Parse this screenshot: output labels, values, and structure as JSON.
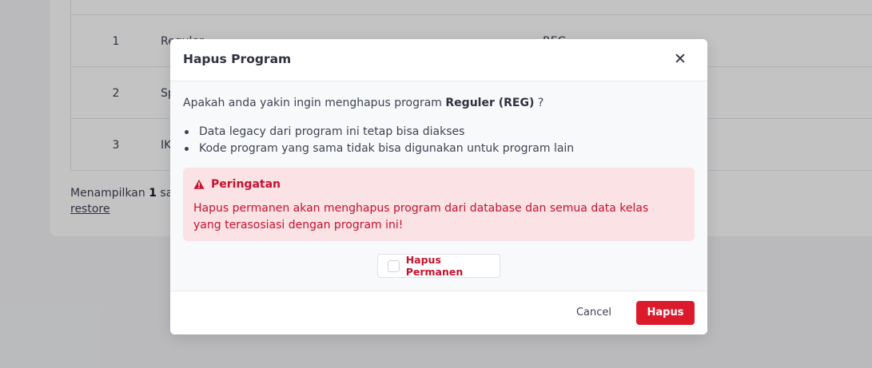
{
  "background": {
    "table": {
      "rows": [
        {
          "no": "1",
          "name": "Reguler",
          "code": "REG"
        },
        {
          "no": "2",
          "name": "Sp"
        },
        {
          "no": "3",
          "name": "IK"
        }
      ]
    },
    "footer": {
      "prefix": "Menampilkan ",
      "count": "1",
      "suffix": " sa",
      "restore_link": "restore"
    }
  },
  "modal": {
    "title": "Hapus Program",
    "close_icon": "close-icon",
    "question_prefix": "Apakah anda yakin ingin menghapus program ",
    "question_program": "Reguler (REG)",
    "question_suffix": " ?",
    "bullets": [
      "Data legacy dari program ini tetap bisa diakses",
      "Kode program yang sama tidak bisa digunakan untuk program lain"
    ],
    "warning": {
      "icon": "warning-triangle-icon",
      "title": "Peringatan",
      "text": "Hapus permanen akan menghapus program dari database dan semua data kelas yang terasosiasi dengan program ini!"
    },
    "permanent_checkbox": {
      "label": "Hapus Permanen",
      "checked": false
    },
    "footer": {
      "cancel_label": "Cancel",
      "confirm_label": "Hapus"
    }
  },
  "colors": {
    "danger": "#db1b2c",
    "danger_text": "#c4122f",
    "warning_bg": "#fbe2e4",
    "overlay": "rgba(0,0,0,0.235)"
  }
}
